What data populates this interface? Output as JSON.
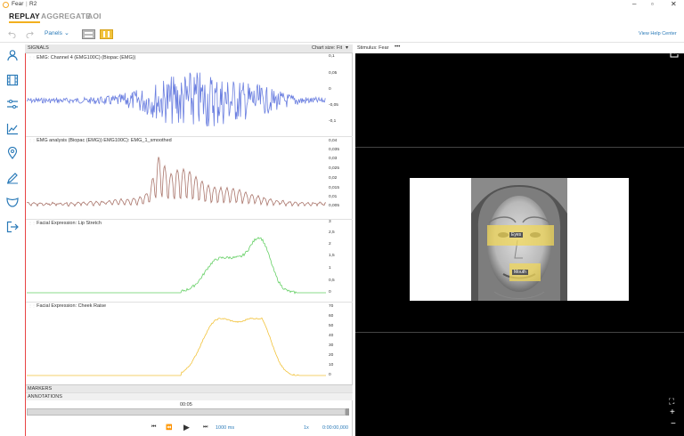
{
  "window": {
    "app_name": "Fear",
    "separator": "|",
    "study": "R2"
  },
  "tabs": [
    {
      "label": "REPLAY",
      "active": true
    },
    {
      "label": "AGGREGATE",
      "active": false
    },
    {
      "label": "AOI",
      "active": false
    }
  ],
  "toolbar": {
    "panels_label": "Panels",
    "help_label": "View Help Center"
  },
  "signals": {
    "header": "SIGNALS",
    "chart_size_label": "Chart size:",
    "chart_size_value": "Fit",
    "charts": [
      {
        "label": "EMG: Channel 4 (EMG100C) (Biopac (EMG))",
        "ticks": [
          "0,1",
          "0,05",
          "0",
          "-0,05",
          "-0,1"
        ],
        "color": "#6b7fe0"
      },
      {
        "label": "EMG analysis (Biopac (EMG)) EMG100C): EMG_1_smoothed",
        "ticks": [
          "0,04",
          "0,035",
          "0,03",
          "0,025",
          "0,02",
          "0,015",
          "0,01",
          "0,005"
        ],
        "color": "#a9746a"
      },
      {
        "label": "Facial Expression: Lip Stretch",
        "ticks": [
          "3",
          "2,5",
          "2",
          "1,5",
          "1",
          "0,5",
          "0"
        ],
        "color": "#66d066"
      },
      {
        "label": "Facial Expression: Cheek Raise",
        "ticks": [
          "70",
          "60",
          "50",
          "40",
          "30",
          "20",
          "10",
          "0"
        ],
        "color": "#f2c33c"
      }
    ],
    "markers_label": "MARKERS",
    "annotations_label": "ANNOTATIONS",
    "timeline_time": "00:05"
  },
  "playback": {
    "interval": "1000 ms",
    "speed": "1x",
    "timecode": "0:00:00,000"
  },
  "stimulus": {
    "header": "Stimulus: Fear",
    "aois": [
      {
        "label": "Eyes"
      },
      {
        "label": "Mouth"
      }
    ]
  }
}
